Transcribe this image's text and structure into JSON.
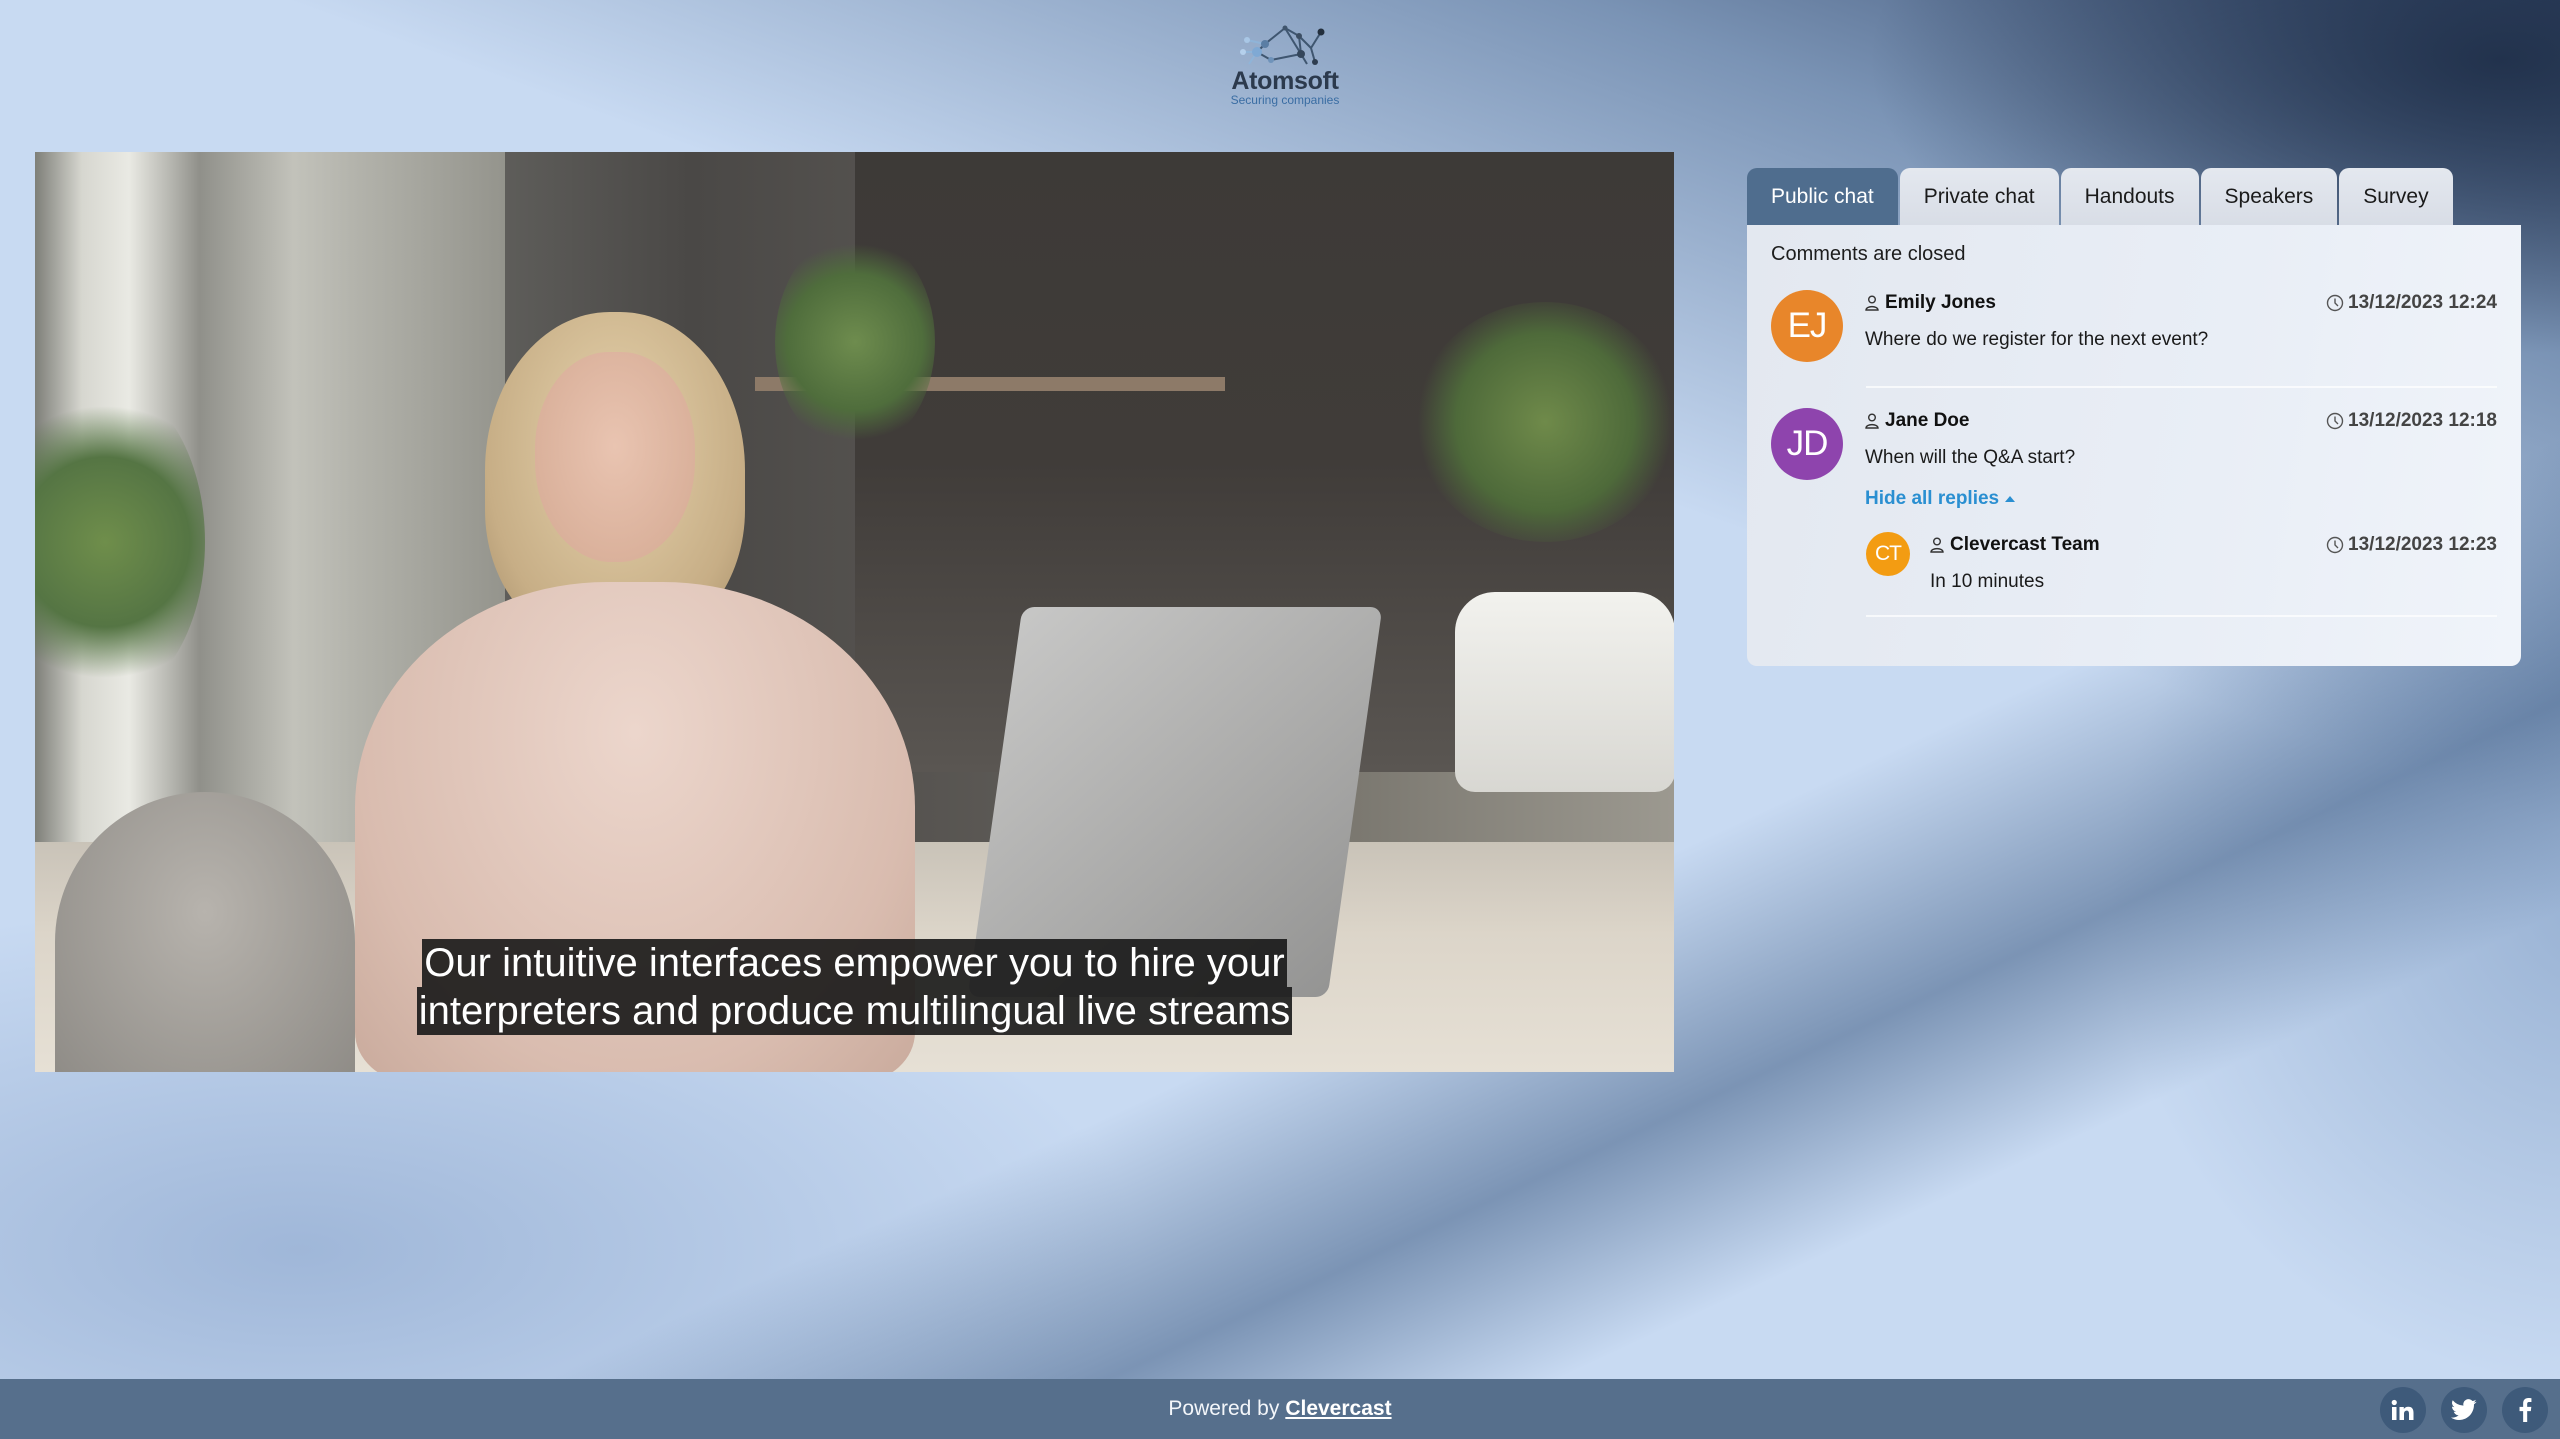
{
  "logo": {
    "name": "Atomsoft",
    "tagline": "Securing companies",
    "icon": "molecule-network-icon"
  },
  "video": {
    "subtitle_lines": [
      "Our intuitive interfaces empower you to hire your",
      "interpreters and produce multilingual live streams"
    ]
  },
  "chat": {
    "tabs": [
      {
        "label": "Public chat",
        "active": true
      },
      {
        "label": "Private chat",
        "active": false
      },
      {
        "label": "Handouts",
        "active": false
      },
      {
        "label": "Speakers",
        "active": false
      },
      {
        "label": "Survey",
        "active": false
      }
    ],
    "status_note": "Comments are closed",
    "messages": [
      {
        "initials": "EJ",
        "avatar_color": "#e8862a",
        "author": "Emily Jones",
        "timestamp": "13/12/2023 12:24",
        "text": "Where do we register for the next event?"
      },
      {
        "initials": "JD",
        "avatar_color": "#8e44ad",
        "author": "Jane Doe",
        "timestamp": "13/12/2023 12:18",
        "text": "When will the Q&A start?",
        "replies_toggle": "Hide all replies",
        "replies": [
          {
            "initials": "CT",
            "avatar_color": "#f39c12",
            "author": "Clevercast Team",
            "timestamp": "13/12/2023 12:23",
            "text": "In 10 minutes"
          }
        ]
      }
    ],
    "icons": {
      "user": "user-icon",
      "clock": "clock-icon",
      "caret": "caret-up-icon"
    }
  },
  "footer": {
    "powered_prefix": "Powered by",
    "powered_link": "Clevercast",
    "social": [
      {
        "name": "linkedin",
        "glyph": "in"
      },
      {
        "name": "twitter",
        "glyph": ""
      },
      {
        "name": "facebook",
        "glyph": "f"
      }
    ]
  }
}
